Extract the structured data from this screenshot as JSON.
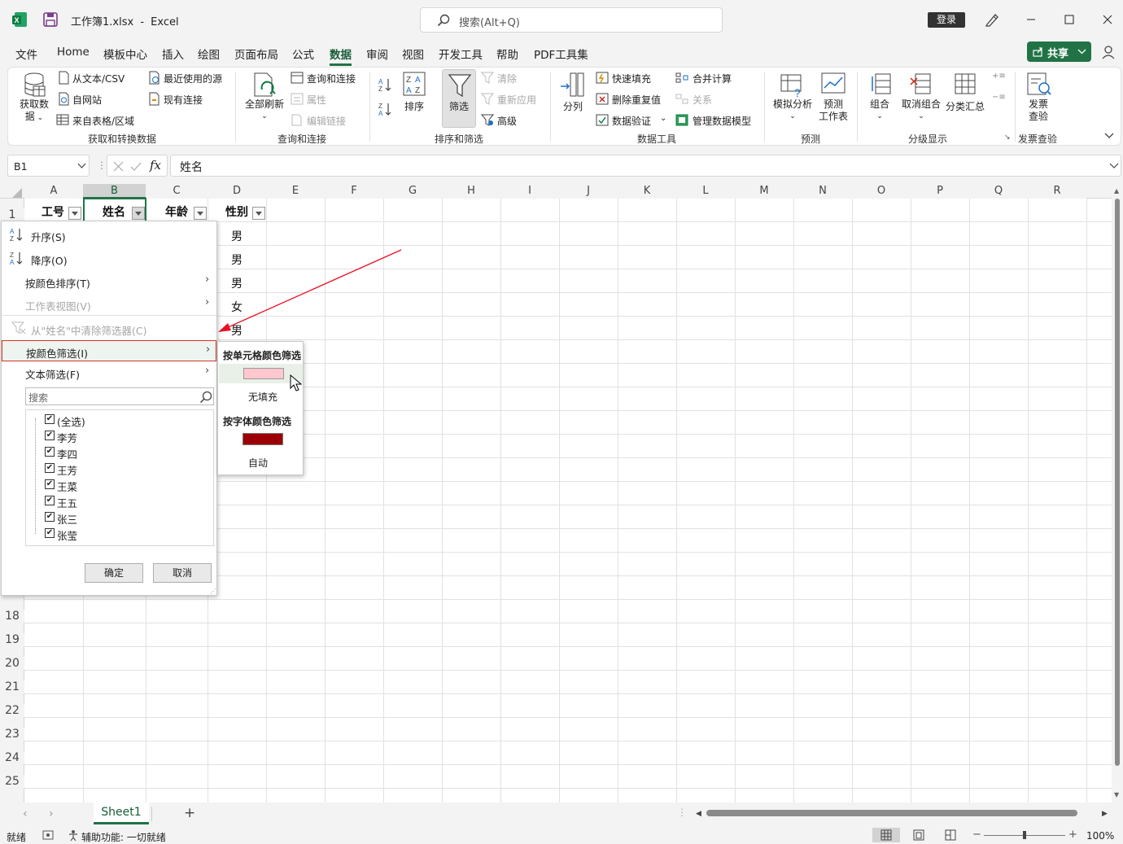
{
  "titlebar": {
    "filename": "工作簿1.xlsx",
    "separator": "-",
    "app": "Excel",
    "search_placeholder": "搜索(Alt+Q)",
    "signin": "登录",
    "share": "共享"
  },
  "menu": {
    "items": [
      "文件",
      "Home",
      "模板中心",
      "插入",
      "绘图",
      "页面布局",
      "公式",
      "数据",
      "审阅",
      "视图",
      "开发工具",
      "帮助",
      "PDF工具集"
    ],
    "active": "数据"
  },
  "ribbon": {
    "get_data_1": "获取数",
    "get_data_2": "据",
    "from_text": "从文本/CSV",
    "from_web": "自网站",
    "from_table": "来自表格/区域",
    "recent_sources": "最近使用的源",
    "existing_conn": "现有连接",
    "group_get": "获取和转换数据",
    "refresh_all": "全部刷新",
    "queries": "查询和连接",
    "properties": "属性",
    "edit_links": "编辑链接",
    "group_queries": "查询和连接",
    "sort": "排序",
    "filter": "筛选",
    "clear": "清除",
    "reapply": "重新应用",
    "advanced": "高级",
    "group_sort": "排序和筛选",
    "split": "分列",
    "flash_fill": "快速填充",
    "remove_dup": "删除重复值",
    "validation": "数据验证",
    "consolidate": "合并计算",
    "relations": "关系",
    "data_model": "管理数据模型",
    "group_tools": "数据工具",
    "what_if": "模拟分析",
    "forecast_1": "预测",
    "forecast_2": "工作表",
    "group_forecast": "预测",
    "group_btn": "组合",
    "ungroup_btn": "取消组合",
    "subtotal": "分类汇总",
    "group_outline": "分级显示",
    "invoice_1": "发票",
    "invoice_2": "查验",
    "group_invoice": "发票查验"
  },
  "formula": {
    "namebox": "B1",
    "fx": "fx",
    "content": "姓名"
  },
  "columns": [
    "A",
    "B",
    "C",
    "D",
    "E",
    "F",
    "G",
    "H",
    "I",
    "J",
    "K",
    "L",
    "M",
    "N",
    "O",
    "P",
    "Q",
    "R"
  ],
  "rows_visible": [
    "1",
    "18",
    "19",
    "20",
    "21",
    "22",
    "23",
    "24",
    "25"
  ],
  "headers": {
    "a": "工号",
    "b": "姓名",
    "c": "年龄",
    "d": "性别"
  },
  "gender_values": [
    "男",
    "男",
    "男",
    "女",
    "男"
  ],
  "dropdown": {
    "sort_asc": "升序(S)",
    "sort_desc": "降序(O)",
    "sort_by_color": "按颜色排序(T)",
    "sheet_view": "工作表视图(V)",
    "clear_filter": "从\"姓名\"中清除筛选器(C)",
    "filter_by_color": "按颜色筛选(I)",
    "text_filter": "文本筛选(F)",
    "search_placeholder": "搜索",
    "checklist": [
      "(全选)",
      "李芳",
      "李四",
      "王芳",
      "王菜",
      "王五",
      "张三",
      "张莹"
    ],
    "ok": "确定",
    "cancel": "取消"
  },
  "submenu": {
    "cell_color_title": "按单元格颜色筛选",
    "no_fill": "无填充",
    "font_color_title": "按字体颜色筛选",
    "auto": "自动",
    "cell_swatch_color": "#ffc7ce",
    "font_swatch_color": "#9c0006"
  },
  "sheets": {
    "active": "Sheet1",
    "add": "+"
  },
  "status": {
    "ready": "就绪",
    "accessibility": "辅助功能: 一切就绪",
    "zoom": "100%"
  },
  "colors": {
    "accent": "#217346",
    "highlight_border": "#d9342b",
    "arrow": "#e81123"
  }
}
